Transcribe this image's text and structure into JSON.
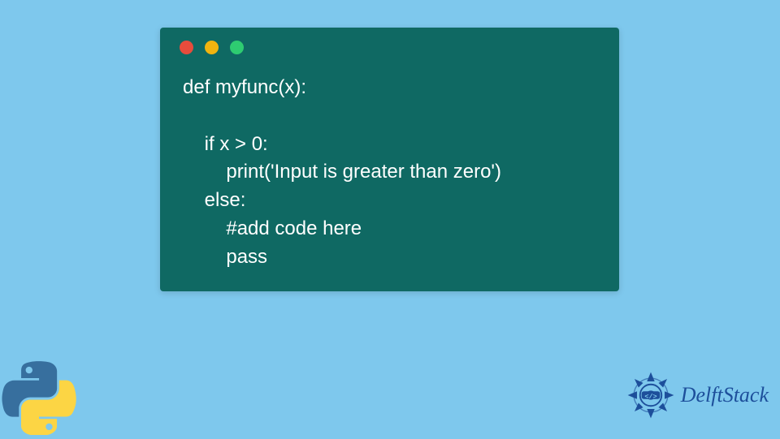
{
  "code": {
    "line1": "def myfunc(x):",
    "line2": "",
    "line3": "    if x > 0:",
    "line4": "        print('Input is greater than zero')",
    "line5": "    else:",
    "line6": "        #add code here",
    "line7": "        pass"
  },
  "branding": {
    "name": "DelftStack"
  },
  "colors": {
    "background": "#7ec8ed",
    "codeWindow": "#0f6963",
    "codeText": "#ffffff",
    "dotRed": "#e74c3c",
    "dotYellow": "#f1b40f",
    "dotGreen": "#2ecc71",
    "pythonBlue": "#376f9e",
    "pythonYellow": "#fcd544",
    "delftBlue": "#1d4f9b"
  }
}
